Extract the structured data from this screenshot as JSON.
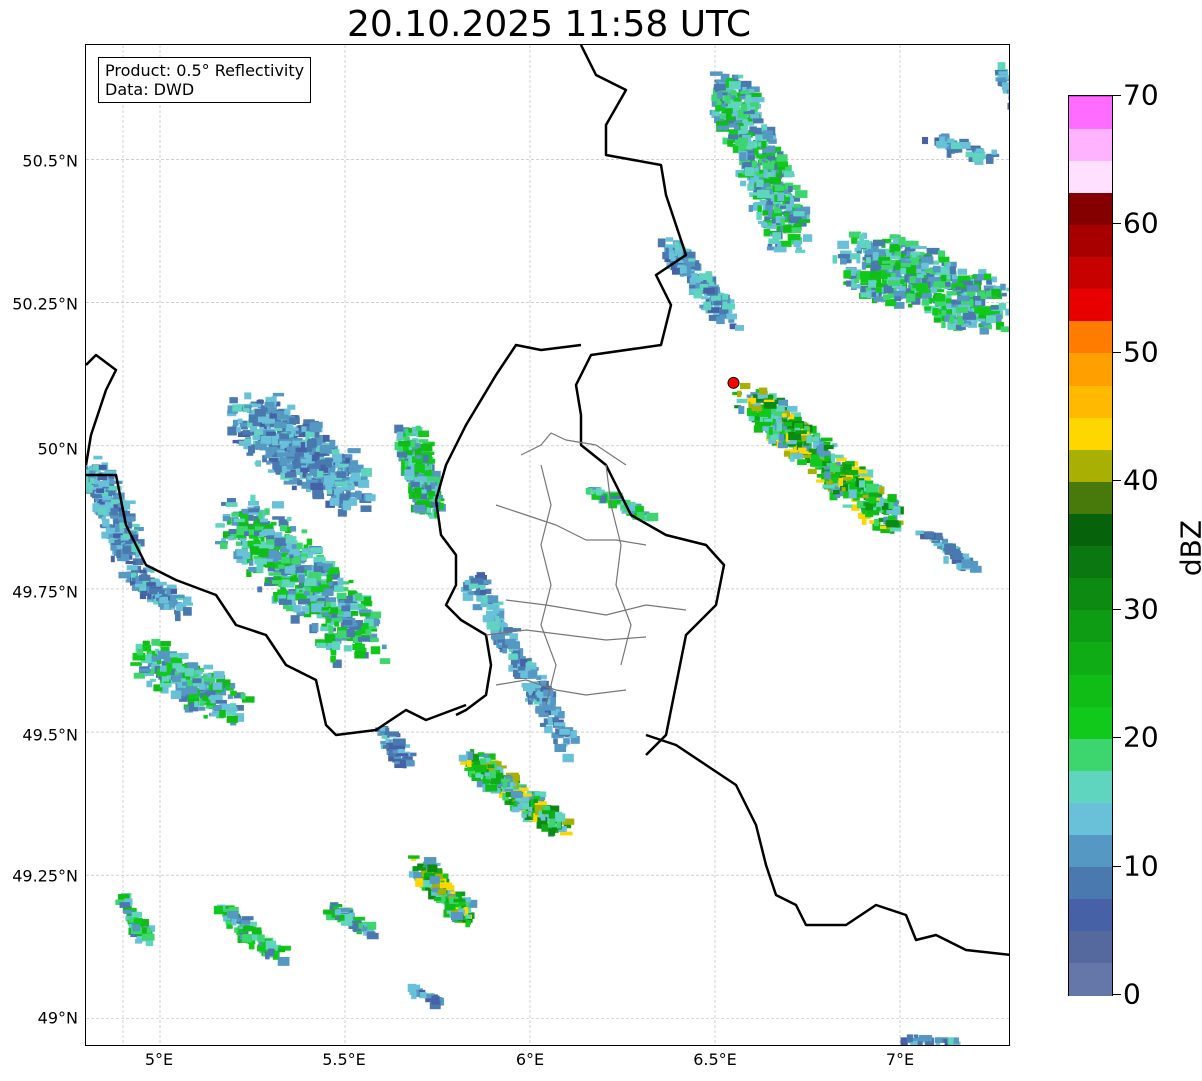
{
  "title": "20.10.2025 11:58 UTC",
  "infobox": {
    "line1": "Product: 0.5° Reflectivity",
    "line2": "Data: DWD"
  },
  "axes": {
    "y_labels": [
      "50.5°N",
      "50.25°N",
      "50°N",
      "49.75°N",
      "49.5°N",
      "49.25°N",
      "49°N"
    ],
    "x_labels": [
      "5°E",
      "5.5°E",
      "6°E",
      "6.5°E",
      "7°E"
    ],
    "lon_range": [
      4.8,
      7.3
    ],
    "lat_range": [
      48.95,
      50.7
    ],
    "grid": true
  },
  "radar_site": {
    "lon": 6.55,
    "lat": 50.11,
    "color": "#ff0000"
  },
  "colorbar": {
    "unit": "dBZ",
    "tick_labels": [
      "0",
      "10",
      "20",
      "30",
      "40",
      "50",
      "60",
      "70"
    ],
    "range": [
      0,
      70
    ],
    "step": 2.5,
    "colors": [
      "#6477a8",
      "#55699f",
      "#4661a5",
      "#4a79b0",
      "#5598c3",
      "#68c0d9",
      "#5fd5bf",
      "#3dd56e",
      "#11c91b",
      "#10bd17",
      "#0fac16",
      "#0e9c14",
      "#0c8a12",
      "#0b7710",
      "#06620b",
      "#477a0b",
      "#a8b003",
      "#ffd700",
      "#ffba00",
      "#ff9f00",
      "#ff7c00",
      "#e80000",
      "#c70000",
      "#a80000",
      "#840000",
      "#ffe0ff",
      "#ffb3ff",
      "#ff6cff",
      "#eb36eb"
    ]
  }
}
